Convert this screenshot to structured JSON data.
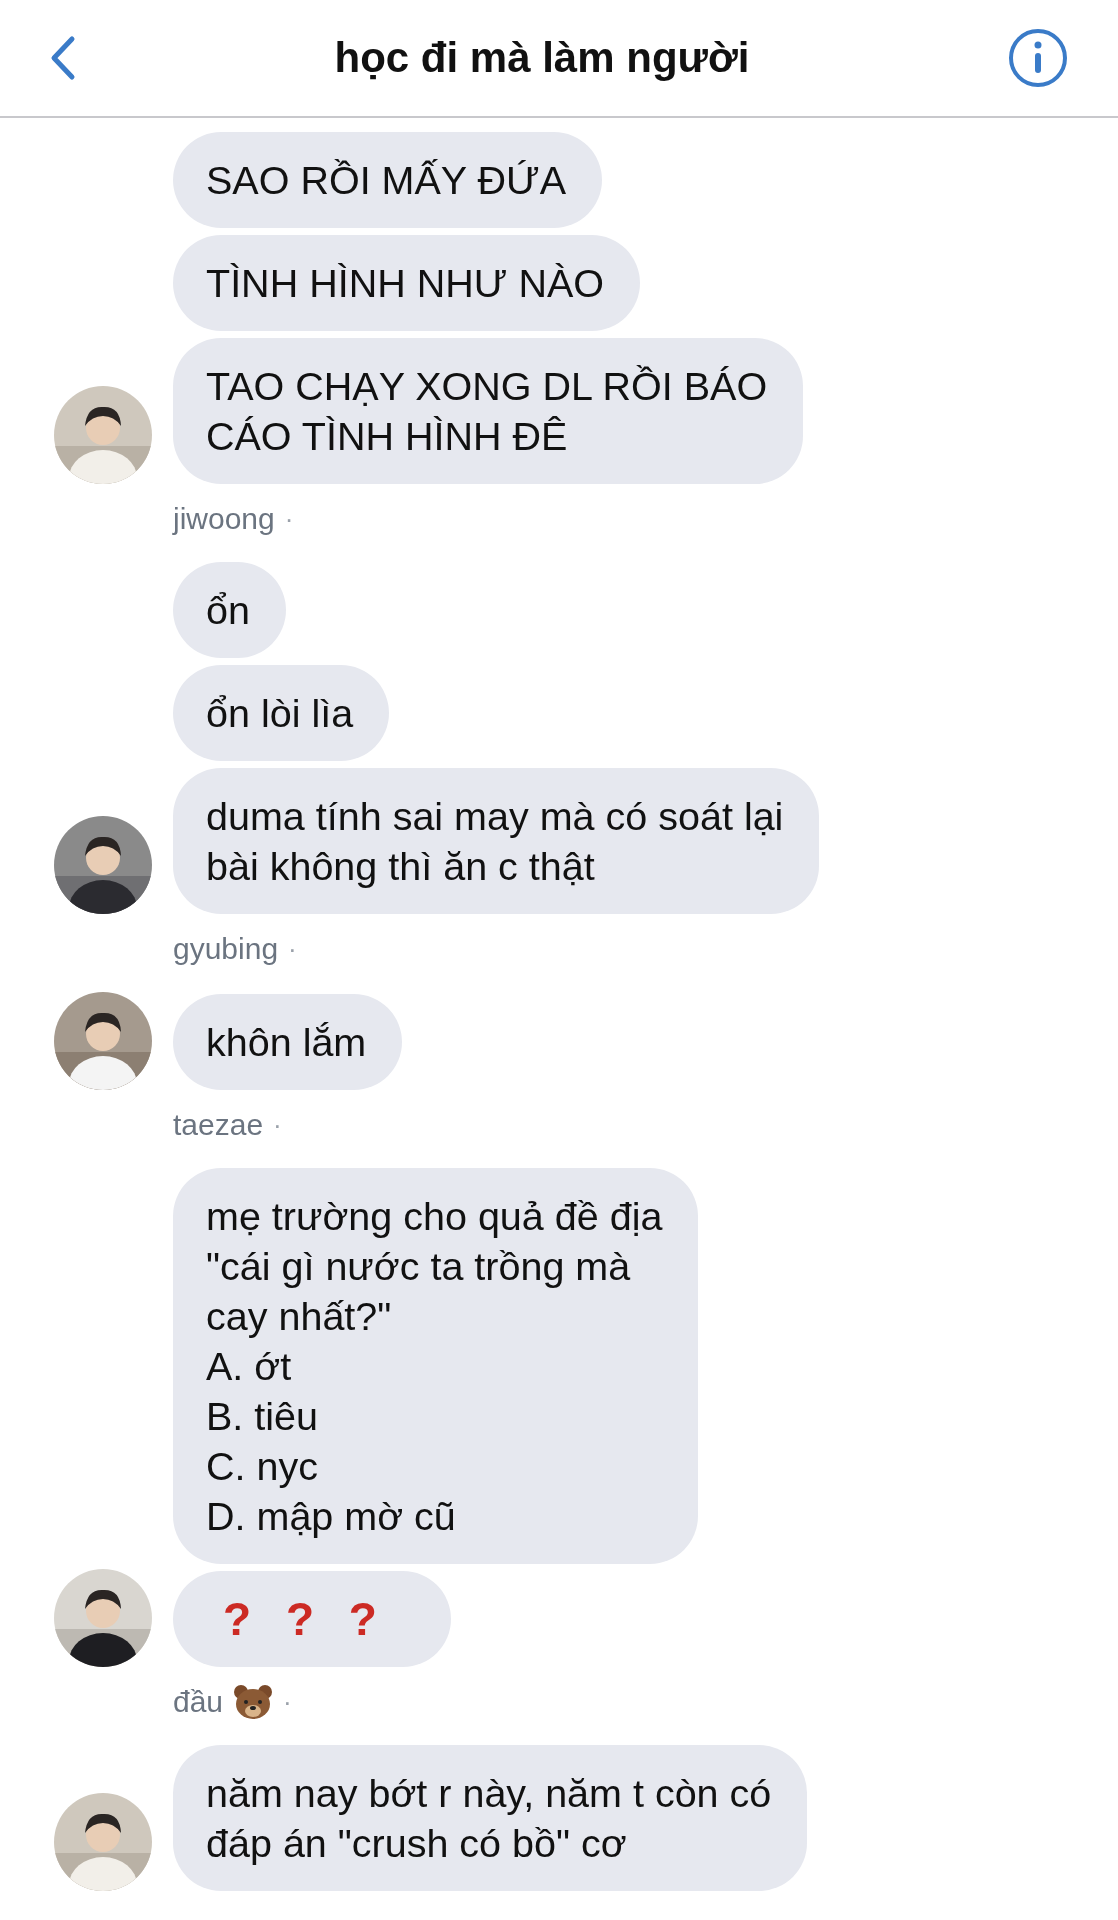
{
  "header": {
    "title": "học đi mà làm người"
  },
  "groups": [
    {
      "sender": {
        "name": "jiwoong",
        "bear_icon": false,
        "separator": "·"
      },
      "messages": [
        {
          "kind": "text",
          "text": "SAO RỒI MẤY ĐỨA"
        },
        {
          "kind": "text",
          "text": "TÌNH HÌNH NHƯ NÀO"
        },
        {
          "kind": "text",
          "text": "TAO CHẠY XONG DL RỒI BÁO\nCÁO TÌNH HÌNH ĐÊ"
        }
      ]
    },
    {
      "sender": {
        "name": "gyubing",
        "bear_icon": false,
        "separator": "·"
      },
      "messages": [
        {
          "kind": "text",
          "text": "ổn"
        },
        {
          "kind": "text",
          "text": "ổn lòi lìa"
        },
        {
          "kind": "text",
          "text": "duma tính sai may mà có soát lại\nbài không thì ăn c thật"
        }
      ]
    },
    {
      "sender": {
        "name": "taezae",
        "bear_icon": false,
        "separator": "·"
      },
      "messages": [
        {
          "kind": "text",
          "text": "khôn lắm"
        }
      ]
    },
    {
      "sender": {
        "name": "đầu",
        "bear_icon": true,
        "separator": "·"
      },
      "messages": [
        {
          "kind": "text",
          "text": "mẹ trường cho quả đề địa\n\"cái gì nước ta trồng mà\ncay nhất?\"\nA. ớt\nB. tiêu\nC. nyc\nD. mập mờ cũ"
        },
        {
          "kind": "marks",
          "text": "? ? ?"
        }
      ]
    },
    {
      "messages": [
        {
          "kind": "text",
          "text": "năm nay bớt r này, năm t còn có\nđáp án \"crush có bồ\" cơ"
        }
      ]
    }
  ]
}
